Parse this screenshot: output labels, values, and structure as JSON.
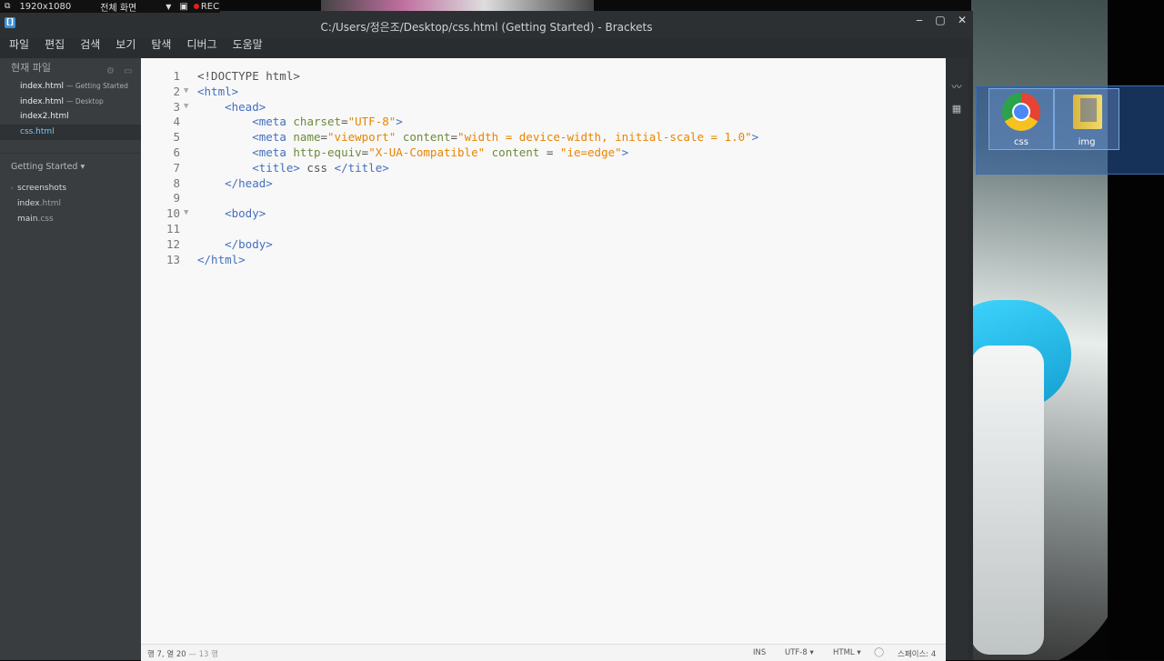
{
  "recorder": {
    "resolution": "1920x1080",
    "mode": "전체 화면",
    "rec_label": "REC"
  },
  "window": {
    "title": "C:/Users/정은조/Desktop/css.html (Getting Started) - Brackets",
    "controls": {
      "minimize": "‒",
      "maximize": "▢",
      "close": "✕"
    }
  },
  "menu": [
    "파일",
    "편집",
    "검색",
    "보기",
    "탐색",
    "디버그",
    "도움말"
  ],
  "sidebar": {
    "working_files_title": "현재 파일",
    "working_files": [
      {
        "name": "index.html",
        "dir": "— Getting Started",
        "active": false
      },
      {
        "name": "index.html",
        "dir": "— Desktop",
        "active": false
      },
      {
        "name": "index2.html",
        "dir": "",
        "active": false
      },
      {
        "name": "css.html",
        "dir": "",
        "active": true
      }
    ],
    "project_title": "Getting Started ▾",
    "tree": [
      {
        "name": "screenshots",
        "ext": "",
        "folder": true
      },
      {
        "name": "index",
        "ext": ".html",
        "folder": false
      },
      {
        "name": "main",
        "ext": ".css",
        "folder": false
      }
    ]
  },
  "editor": {
    "lines": [
      {
        "n": "1",
        "fold": false,
        "html": "<span class='d'>&lt;!DOCTYPE html&gt;</span>"
      },
      {
        "n": "2",
        "fold": true,
        "html": "<span class='t'>&lt;html&gt;</span>"
      },
      {
        "n": "3",
        "fold": true,
        "html": "    <span class='t'>&lt;head&gt;</span>"
      },
      {
        "n": "4",
        "fold": false,
        "html": "        <span class='t'>&lt;meta</span> <span class='a'>charset</span>=<span class='s'>\"UTF-8\"</span><span class='t'>&gt;</span>"
      },
      {
        "n": "5",
        "fold": false,
        "html": "        <span class='t'>&lt;meta</span> <span class='a'>name</span>=<span class='s'>\"viewport\"</span> <span class='a'>content</span>=<span class='s'>\"width = device-width, initial-scale = 1.0\"</span><span class='t'>&gt;</span>"
      },
      {
        "n": "6",
        "fold": false,
        "html": "        <span class='t'>&lt;meta</span> <span class='a'>http-equiv</span>=<span class='s'>\"X-UA-Compatible\"</span> <span class='a'>content</span> = <span class='s'>\"ie=edge\"</span><span class='t'>&gt;</span>"
      },
      {
        "n": "7",
        "fold": false,
        "html": "        <span class='t'>&lt;title&gt;</span> css <span class='t'>&lt;/title&gt;</span>"
      },
      {
        "n": "8",
        "fold": false,
        "html": "    <span class='t'>&lt;/head&gt;</span>"
      },
      {
        "n": "9",
        "fold": false,
        "html": ""
      },
      {
        "n": "10",
        "fold": true,
        "html": "    <span class='t'>&lt;body&gt;</span>"
      },
      {
        "n": "11",
        "fold": false,
        "html": ""
      },
      {
        "n": "12",
        "fold": false,
        "html": "    <span class='t'>&lt;/body&gt;</span>"
      },
      {
        "n": "13",
        "fold": false,
        "html": "<span class='t'>&lt;/html&gt;</span>"
      }
    ]
  },
  "status": {
    "cursor": "행 7, 열 20",
    "line_count": "— 13 행",
    "ins": "INS",
    "encoding": "UTF-8 ▾",
    "language": "HTML ▾",
    "spaces": "스페이스: 4"
  },
  "desktop_icons": [
    {
      "label": "css",
      "type": "chrome"
    },
    {
      "label": "img",
      "type": "folder"
    }
  ]
}
